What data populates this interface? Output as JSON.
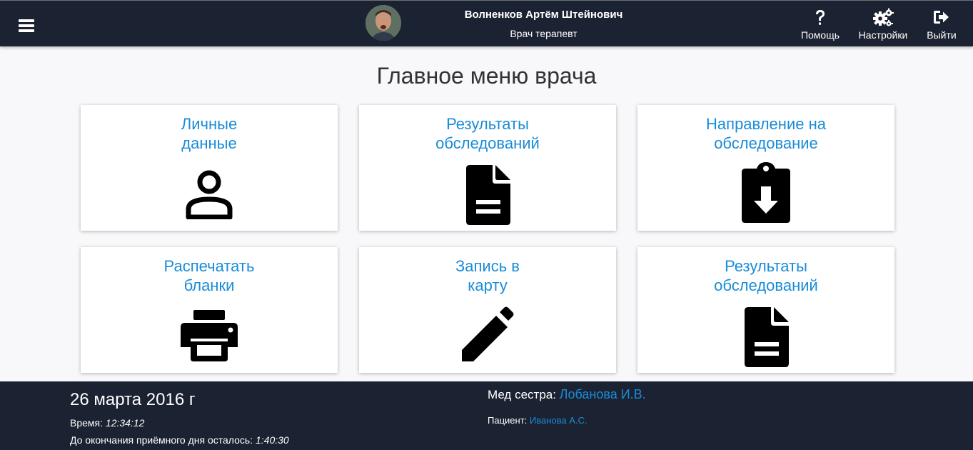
{
  "header": {
    "doctor_name": "Волненков Артём Штейнович",
    "doctor_role": "Врач терапевт",
    "actions": {
      "help": "Помощь",
      "settings": "Настройки",
      "exit": "Выйти"
    }
  },
  "page_title": "Главное меню врача",
  "cards": [
    {
      "line1": "Личные",
      "line2": "данные",
      "icon": "person-icon"
    },
    {
      "line1": "Результаты",
      "line2": "обследований",
      "icon": "document-icon"
    },
    {
      "line1": "Направление на",
      "line2": "обследование",
      "icon": "clipboard-download-icon"
    },
    {
      "line1": "Распечатать",
      "line2": "бланки",
      "icon": "printer-icon"
    },
    {
      "line1": "Запись в",
      "line2": "карту",
      "icon": "pencil-icon"
    },
    {
      "line1": "Результаты",
      "line2": "обследований",
      "icon": "document-icon"
    }
  ],
  "footer": {
    "date": "26 марта 2016 г",
    "time_label": "Время: ",
    "time_value": "12:34:12",
    "remaining_label": "До окончания приёмного дня осталось: ",
    "remaining_value": "1:40:30",
    "nurse_label": "Мед сестра: ",
    "nurse_value": "Лобанова И.В.",
    "patient_label": "Пациент: ",
    "patient_value": "Иванова А.С."
  },
  "colors": {
    "bar_bg": "#1b2232",
    "accent": "#1a8cd8",
    "card_bg": "#ffffff"
  }
}
